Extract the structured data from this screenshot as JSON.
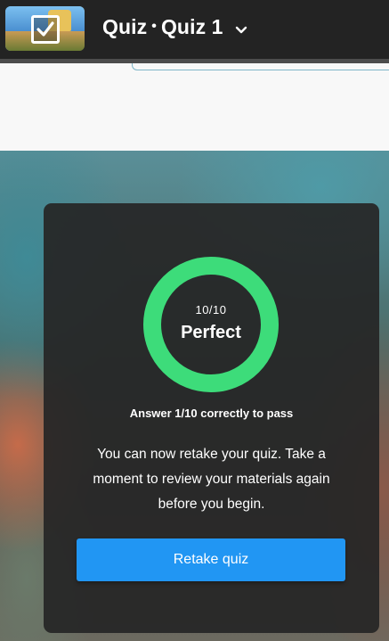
{
  "header": {
    "quiz_label": "Quiz",
    "separator": "•",
    "quiz_name": "Quiz 1",
    "thumbnail_icon": "checkbox-checked-icon",
    "dropdown_icon": "chevron-down-icon"
  },
  "result": {
    "score": "10/10",
    "score_fraction": 1.0,
    "verdict": "Perfect",
    "pass_requirement": "Answer 1/10 correctly to pass",
    "message": "You can now retake your quiz. Take a moment to review your materials again before you begin.",
    "retake_label": "Retake quiz"
  },
  "colors": {
    "ring": "#3ddc7a",
    "button": "#2196f3",
    "header_bg": "#232323",
    "card_bg": "#262626"
  }
}
